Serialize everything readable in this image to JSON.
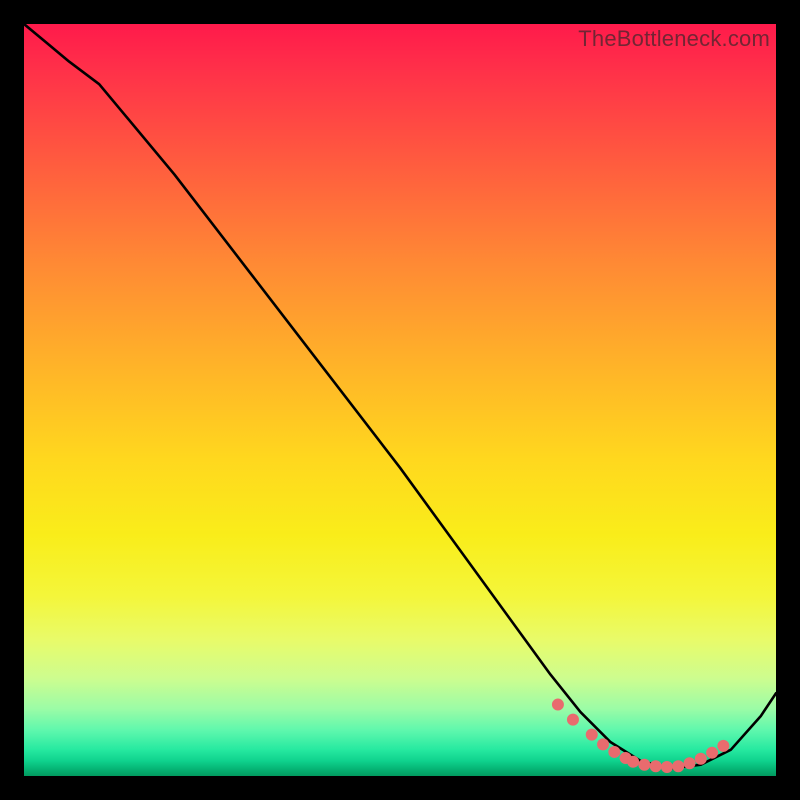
{
  "watermark": "TheBottleneck.com",
  "chart_data": {
    "type": "line",
    "title": "",
    "xlabel": "",
    "ylabel": "",
    "xlim": [
      0,
      100
    ],
    "ylim": [
      0,
      100
    ],
    "series": [
      {
        "name": "curve",
        "x": [
          0,
          3,
          6,
          10,
          20,
          30,
          40,
          50,
          58,
          62,
          66,
          70,
          74,
          78,
          82,
          86,
          90,
          94,
          98,
          100
        ],
        "y": [
          100,
          97.5,
          95,
          92,
          80,
          67,
          54,
          41,
          30,
          24.5,
          19,
          13.5,
          8.5,
          4.5,
          2,
          1,
          1.5,
          3.5,
          8,
          11
        ]
      }
    ],
    "markers": {
      "name": "highlight-dots",
      "color": "#e96b6e",
      "x": [
        71,
        73,
        75.5,
        77,
        78.5,
        80,
        81,
        82.5,
        84,
        85.5,
        87,
        88.5,
        90,
        91.5,
        93
      ],
      "y": [
        9.5,
        7.5,
        5.5,
        4.2,
        3.2,
        2.4,
        1.9,
        1.5,
        1.3,
        1.2,
        1.3,
        1.7,
        2.3,
        3.1,
        4.0
      ]
    },
    "gradient_stops": [
      {
        "pos": 0.0,
        "color": "#ff1a4b"
      },
      {
        "pos": 0.18,
        "color": "#ff5a3f"
      },
      {
        "pos": 0.46,
        "color": "#ffb528"
      },
      {
        "pos": 0.68,
        "color": "#f9ed1a"
      },
      {
        "pos": 0.87,
        "color": "#cdfd8f"
      },
      {
        "pos": 0.96,
        "color": "#26e9a0"
      },
      {
        "pos": 1.0,
        "color": "#029a5f"
      }
    ]
  }
}
